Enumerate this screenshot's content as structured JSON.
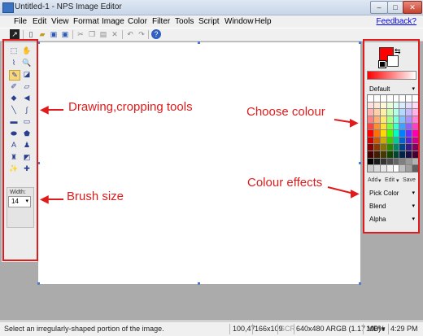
{
  "window": {
    "title": "Untitled-1 - NPS Image Editor",
    "minimize": "–",
    "maximize": "□",
    "close": "✕"
  },
  "menubar": {
    "items": [
      "File",
      "Edit",
      "View",
      "Format",
      "Image",
      "Color",
      "Filter",
      "Tools",
      "Script",
      "Window",
      "Help"
    ],
    "feedback": "Feedback?"
  },
  "toolbar": {
    "icons": [
      "select-tool-icon",
      "new-file-icon",
      "open-folder-icon",
      "save-icon",
      "save-as-icon",
      "print-icon",
      "cut-icon",
      "copy-icon",
      "paste-icon",
      "delete-icon",
      "undo-icon",
      "redo-icon",
      "help-icon"
    ]
  },
  "tools_panel": {
    "tools": [
      {
        "icon": "lasso-select-icon",
        "glyph": "⬚"
      },
      {
        "icon": "hand-icon",
        "glyph": "✋"
      },
      {
        "icon": "eyedropper-icon",
        "glyph": "⌇"
      },
      {
        "icon": "zoom-icon",
        "glyph": "🔍"
      },
      {
        "icon": "pencil-icon",
        "glyph": "✎"
      },
      {
        "icon": "fill-bucket-icon",
        "glyph": "◪"
      },
      {
        "icon": "brush-icon",
        "glyph": "✐"
      },
      {
        "icon": "eraser-icon",
        "glyph": "▱"
      },
      {
        "icon": "clone-icon",
        "glyph": "◆"
      },
      {
        "icon": "smudge-icon",
        "glyph": "◀"
      },
      {
        "icon": "line-icon",
        "glyph": "╲"
      },
      {
        "icon": "curve-icon",
        "glyph": "∫"
      },
      {
        "icon": "rectangle-icon",
        "glyph": "▬"
      },
      {
        "icon": "rounded-rect-icon",
        "glyph": "▭"
      },
      {
        "icon": "ellipse-icon",
        "glyph": "⬬"
      },
      {
        "icon": "freeform-shape-icon",
        "glyph": "⬟"
      },
      {
        "icon": "text-icon",
        "glyph": "A"
      },
      {
        "icon": "stamp-icon",
        "glyph": "♟"
      },
      {
        "icon": "airbrush-icon",
        "glyph": "♜"
      },
      {
        "icon": "color-replace-icon",
        "glyph": "◩"
      },
      {
        "icon": "magic-wand-icon",
        "glyph": "✨"
      },
      {
        "icon": "move-icon",
        "glyph": "✚"
      }
    ],
    "width_label": "Width:",
    "width_value": "14"
  },
  "color_panel": {
    "foreground": "#ff0000",
    "background": "#ffffff",
    "palette_name": "Default",
    "palette_actions": {
      "add": "Add",
      "edit": "Edit",
      "save": "Save"
    },
    "dropdowns": [
      "Pick Color",
      "Blend",
      "Alpha"
    ],
    "swatches": [
      "#ffffff",
      "#ffffff",
      "#ffffff",
      "#ffffff",
      "#ffffff",
      "#ffffff",
      "#ffffff",
      "#ffffff",
      "#ffdede",
      "#ffe8d6",
      "#fff8d6",
      "#e6ffd9",
      "#d9fff4",
      "#d9ecff",
      "#e3dcff",
      "#ffd9f2",
      "#ffb3b3",
      "#ffcfa8",
      "#fff0a8",
      "#ccffb3",
      "#b3ffe9",
      "#b3d9ff",
      "#c7b8ff",
      "#ffb3e6",
      "#ff8080",
      "#ffb070",
      "#ffe870",
      "#a8ff80",
      "#80ffdd",
      "#80c0ff",
      "#a890ff",
      "#ff80d6",
      "#ff4040",
      "#ff9030",
      "#ffe030",
      "#7cff40",
      "#40ffcf",
      "#40a0ff",
      "#8a60ff",
      "#ff40c4",
      "#ff0000",
      "#ff7000",
      "#ffd800",
      "#4cff00",
      "#00ffc0",
      "#0080ff",
      "#6a30ff",
      "#ff00b0",
      "#cc0000",
      "#cc5800",
      "#ccac00",
      "#3ccc00",
      "#00cc9a",
      "#0066cc",
      "#5426cc",
      "#cc008c",
      "#880000",
      "#883a00",
      "#887200",
      "#288800",
      "#008866",
      "#004488",
      "#381988",
      "#88005e",
      "#440000",
      "#441d00",
      "#443900",
      "#144400",
      "#004433",
      "#002244",
      "#1c0c44",
      "#44002f",
      "#000000",
      "#1a1a1a",
      "#333333",
      "#4d4d4d",
      "#666666",
      "#808080",
      "#999999",
      "#b3b3b3",
      "#cccccc",
      "#d9d9d9",
      "#e6e6e6",
      "#f2f2f2",
      "#ffffff",
      "#c0c0c0",
      "#a0a0a0",
      "#606060"
    ]
  },
  "annotations": {
    "tools": "Drawing,cropping tools",
    "colour": "Choose colour",
    "brush": "Brush size",
    "effects": "Colour effects"
  },
  "statusbar": {
    "message": "Select an irregularly-shaped portion of the image.",
    "cursor": "100,47",
    "selection": "166x109",
    "scr": "SCR",
    "image_info": "640x480 ARGB (1.17 MB)",
    "zoom": "100%",
    "zoom_caret": "▾",
    "time": "4:29 PM"
  }
}
